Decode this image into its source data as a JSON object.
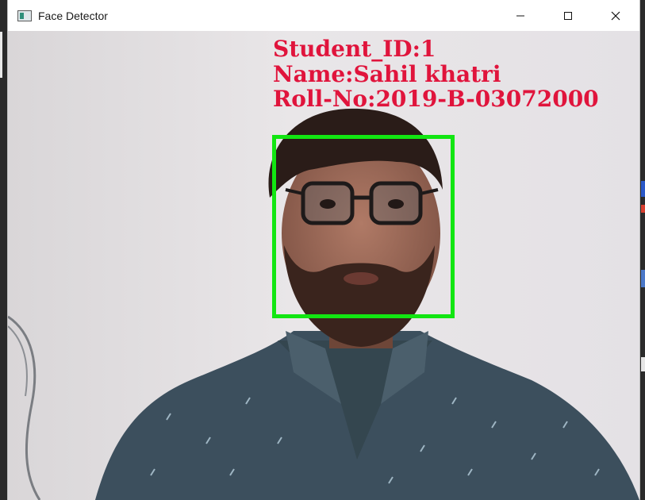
{
  "window": {
    "title": "Face Detector",
    "controls": {
      "minimize": "minimize-icon",
      "maximize": "maximize-icon",
      "close": "close-icon"
    }
  },
  "detection": {
    "student_id_line": "Student_ID:1",
    "name_line": "Name:Sahil khatri",
    "roll_line": "Roll-No:2019-B-03072000",
    "label_color": "#e0143c",
    "box_color": "#12e612"
  }
}
